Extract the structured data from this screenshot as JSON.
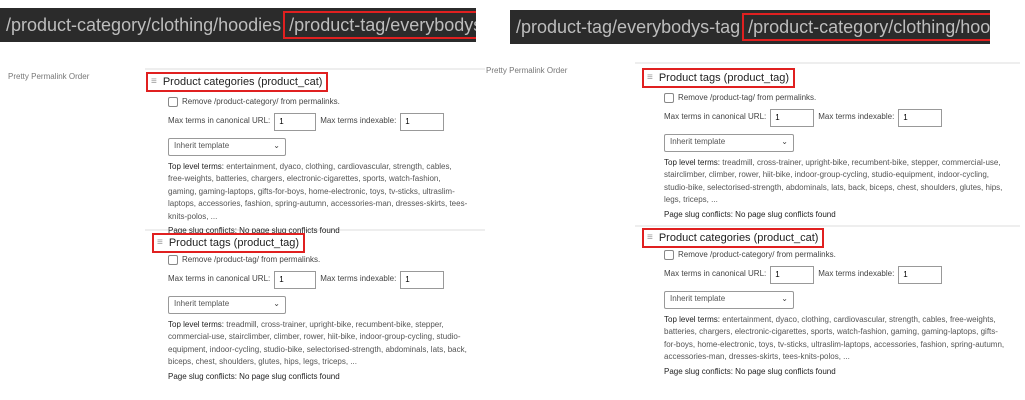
{
  "left": {
    "url_segments": [
      "/product-category/clothing/hoodies",
      "/product-tag/everybodys-tag/"
    ],
    "row_label": "Pretty Permalink Order",
    "sections": [
      {
        "title": "Product categories (product_cat)",
        "remove_label": "Remove /product-category/ from permalinks.",
        "max_canonical_label": "Max terms in canonical URL:",
        "max_canonical_value": "1",
        "max_indexable_label": "Max terms indexable:",
        "max_indexable_value": "1",
        "template_value": "Inherit template",
        "top_terms_label": "Top level terms:",
        "top_terms": "entertainment, dyaco, clothing, cardiovascular, strength, cables, free-weights, batteries, chargers, electronic-cigarettes, sports, watch-fashion, gaming, gaming-laptops, gifts-for-boys, home-electronic, toys, tv-sticks, ultraslim-laptops, accessories, fashion, spring-autumn, accessories-man, dresses-skirts, tees-knits-polos, ...",
        "conflicts_label": "Page slug conflicts:",
        "conflicts_value": "No page slug conflicts found"
      },
      {
        "title": "Product tags (product_tag)",
        "remove_label": "Remove /product-tag/ from permalinks.",
        "max_canonical_label": "Max terms in canonical URL:",
        "max_canonical_value": "1",
        "max_indexable_label": "Max terms indexable:",
        "max_indexable_value": "1",
        "template_value": "Inherit template",
        "top_terms_label": "Top level terms:",
        "top_terms": "treadmill, cross-trainer, upright-bike, recumbent-bike, stepper, commercial-use, stairclimber, climber, rower, hiit-bike, indoor-group-cycling, studio-equipment, indoor-cycling, studio-bike, selectorised-strength, abdominals, lats, back, biceps, chest, shoulders, glutes, hips, legs, triceps, ...",
        "conflicts_label": "Page slug conflicts:",
        "conflicts_value": "No page slug conflicts found"
      }
    ]
  },
  "right": {
    "url_segments": [
      "/product-tag/everybodys-tag",
      "/product-category/clothing/hoodies"
    ],
    "row_label": "Pretty Permalink Order",
    "sections": [
      {
        "title": "Product tags (product_tag)",
        "remove_label": "Remove /product-tag/ from permalinks.",
        "max_canonical_label": "Max terms in canonical URL:",
        "max_canonical_value": "1",
        "max_indexable_label": "Max terms indexable:",
        "max_indexable_value": "1",
        "template_value": "Inherit template",
        "top_terms_label": "Top level terms:",
        "top_terms": "treadmill, cross-trainer, upright-bike, recumbent-bike, stepper, commercial-use, stairclimber, climber, rower, hiit-bike, indoor-group-cycling, studio-equipment, indoor-cycling, studio-bike, selectorised-strength, abdominals, lats, back, biceps, chest, shoulders, glutes, hips, legs, triceps, ...",
        "conflicts_label": "Page slug conflicts:",
        "conflicts_value": "No page slug conflicts found"
      },
      {
        "title": "Product categories (product_cat)",
        "remove_label": "Remove /product-category/ from permalinks.",
        "max_canonical_label": "Max terms in canonical URL:",
        "max_canonical_value": "1",
        "max_indexable_label": "Max terms indexable:",
        "max_indexable_value": "1",
        "template_value": "Inherit template",
        "top_terms_label": "Top level terms:",
        "top_terms": "entertainment, dyaco, clothing, cardiovascular, strength, cables, free-weights, batteries, chargers, electronic-cigarettes, sports, watch-fashion, gaming, gaming-laptops, gifts-for-boys, home-electronic, toys, tv-sticks, ultraslim-laptops, accessories, fashion, spring-autumn, accessories-man, dresses-skirts, tees-knits-polos, ...",
        "conflicts_label": "Page slug conflicts:",
        "conflicts_value": "No page slug conflicts found"
      }
    ]
  },
  "colors": {
    "highlight": "#e02020",
    "url_bar_bg": "#2b2b2b"
  },
  "icons": {
    "drag": "drag-handle-icon",
    "dropdown": "chevron-down-icon"
  }
}
